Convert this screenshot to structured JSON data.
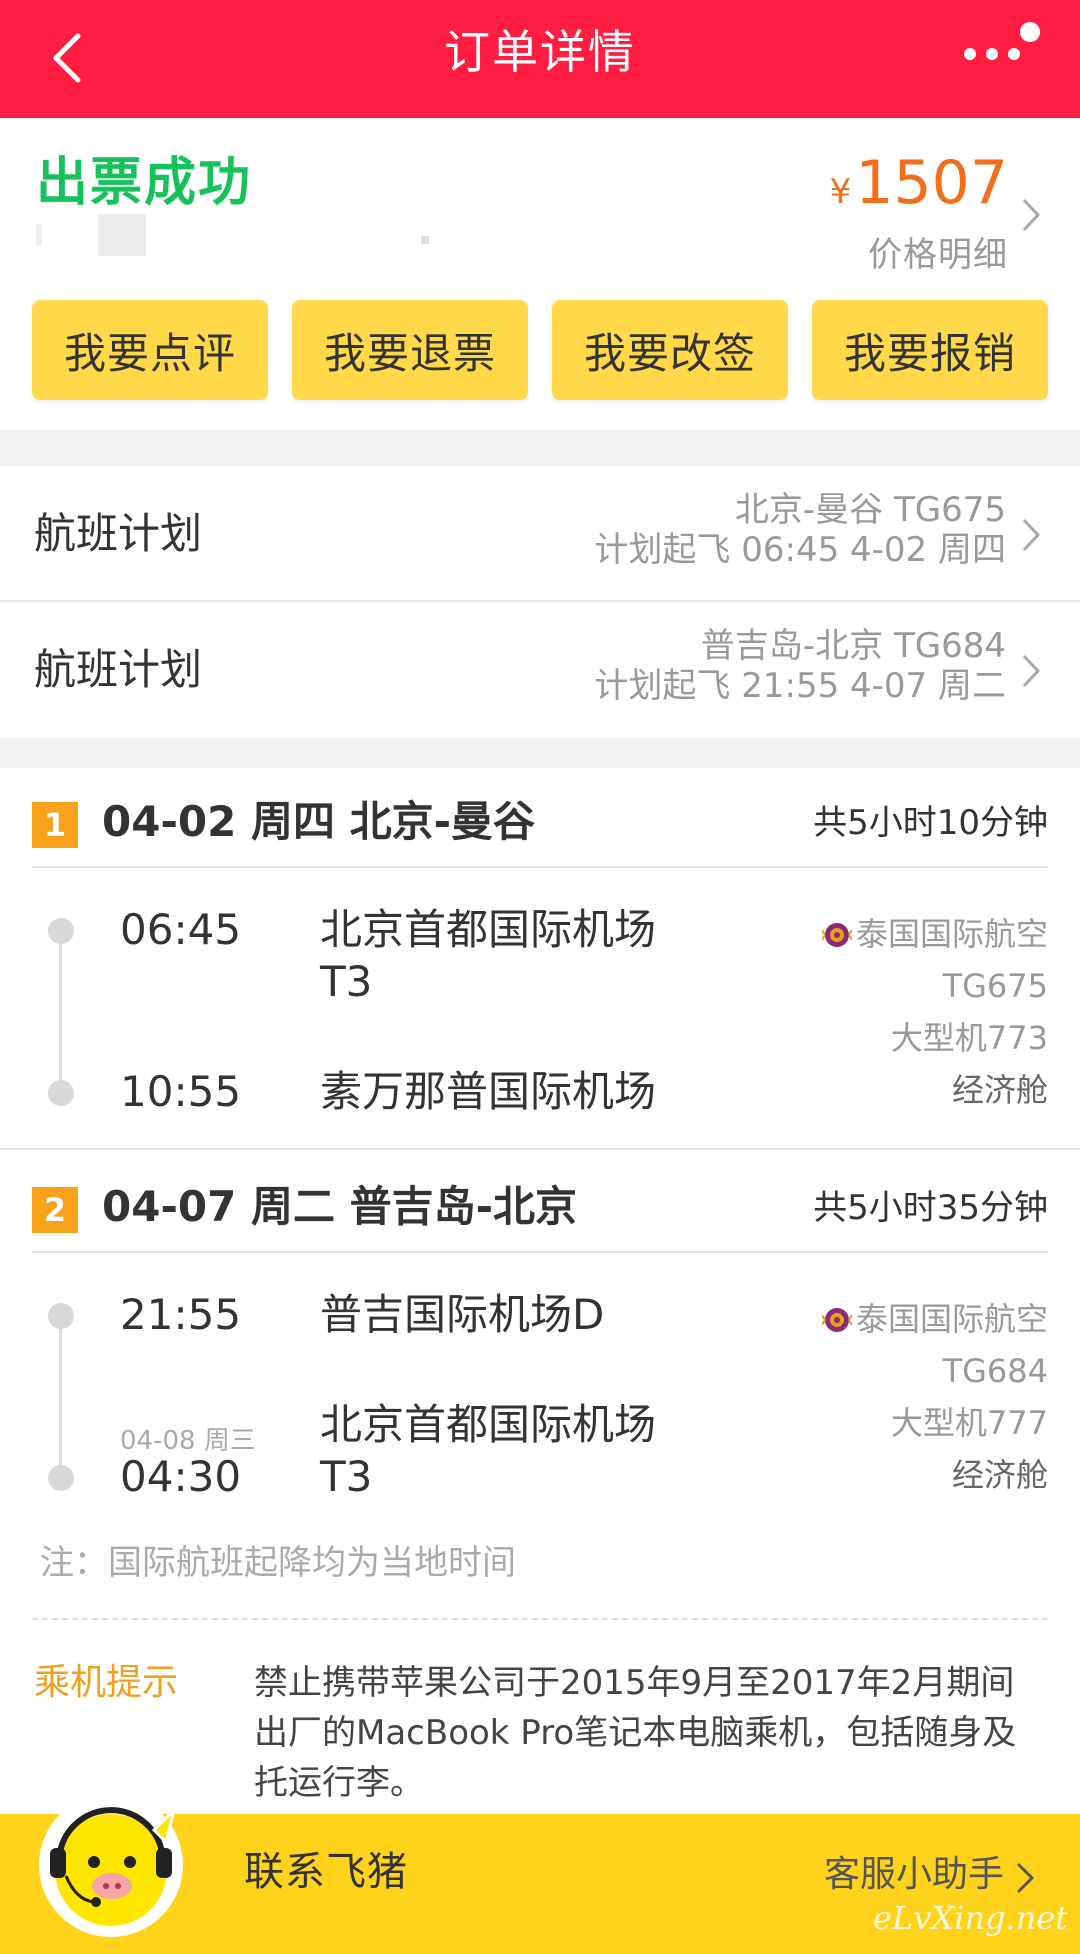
{
  "header": {
    "title": "订单详情"
  },
  "status": {
    "text": "出票成功",
    "price_symbol": "¥",
    "price": "1507",
    "price_detail": "价格明细"
  },
  "actions": [
    {
      "label": "我要点评"
    },
    {
      "label": "我要退票"
    },
    {
      "label": "我要改签"
    },
    {
      "label": "我要报销"
    }
  ],
  "plans": [
    {
      "label": "航班计划",
      "route": "北京-曼谷 TG675",
      "schedule": "计划起飞 06:45 4-02 周四"
    },
    {
      "label": "航班计划",
      "route": "普吉岛-北京 TG684",
      "schedule": "计划起飞 21:55 4-07 周二"
    }
  ],
  "segments": [
    {
      "num": "1",
      "title": "04-02 周四 北京-曼谷",
      "duration": "共5小时10分钟",
      "dep_time": "06:45",
      "dep_airport_line1": "北京首都国际机场",
      "dep_airport_line2": "T3",
      "arr_time": "10:55",
      "arr_next_day": "",
      "arr_airport_line1": "素万那普国际机场",
      "arr_airport_line2": "",
      "airline": "泰国国际航空",
      "flight_no": "TG675",
      "aircraft": "大型机773",
      "cabin": "经济舱"
    },
    {
      "num": "2",
      "title": "04-07 周二 普吉岛-北京",
      "duration": "共5小时35分钟",
      "dep_time": "21:55",
      "dep_airport_line1": "普吉国际机场D",
      "dep_airport_line2": "",
      "arr_time": "04:30",
      "arr_next_day": "04-08 周三",
      "arr_airport_line1": "北京首都国际机场",
      "arr_airport_line2": "T3",
      "airline": "泰国国际航空",
      "flight_no": "TG684",
      "aircraft": "大型机777",
      "cabin": "经济舱"
    }
  ],
  "note": "注：国际航班起降均为当地时间",
  "tip": {
    "label": "乘机提示",
    "text": "禁止携带苹果公司于2015年9月至2017年2月期间出厂的MacBook Pro笔记本电脑乘机，包括随身及托运行李。"
  },
  "footer": {
    "contact": "联系飞猪",
    "helper": "客服小助手",
    "watermark": "eLvXing.net"
  },
  "colors": {
    "header_bg": "#ff1e42",
    "status_green": "#16c35a",
    "price_orange": "#f26d1c",
    "button_yellow": "#ffd94a",
    "segment_badge": "#f7a21b",
    "tip_label": "#f0a020",
    "footer_yellow": "#ffd21c"
  },
  "icons": {
    "back": "chevron-left-icon",
    "more": "more-dots-icon",
    "chevron": "chevron-right-icon",
    "airline_logo": "thai-airways-logo-icon",
    "mascot": "fliggy-mascot-icon"
  }
}
